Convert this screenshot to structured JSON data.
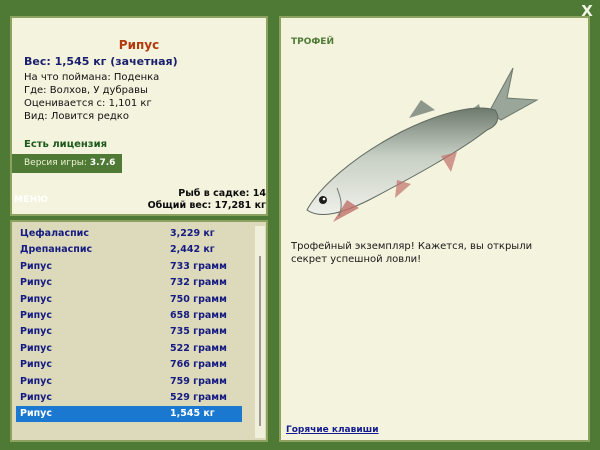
{
  "window": {
    "close_label": "X"
  },
  "catch_info": {
    "fish_name": "Рипус",
    "weight": "Вес: 1,545 кг (зачетная)",
    "bait": "На что поймана: Поденка",
    "location": "Где: Волхов, У дубравы",
    "valued_from": "Оценивается с: 1,101 кг",
    "kind": "Вид: Ловится редко",
    "license": "Есть лицензия",
    "version_label": "Версия игры:",
    "version_value": "3.7.6"
  },
  "menu_label": "МЕНЮ",
  "summary": {
    "fish_count": "Рыб в садке: 14",
    "total_weight": "Общий вес: 17,281 кг"
  },
  "catch_list": [
    {
      "name": "Цефаласпис",
      "weight": "3,229 кг"
    },
    {
      "name": "Дрепанаспис",
      "weight": "2,442 кг"
    },
    {
      "name": "Рипус",
      "weight": "733 грамм"
    },
    {
      "name": "Рипус",
      "weight": "732 грамм"
    },
    {
      "name": "Рипус",
      "weight": "750 грамм"
    },
    {
      "name": "Рипус",
      "weight": "658 грамм"
    },
    {
      "name": "Рипус",
      "weight": "735 грамм"
    },
    {
      "name": "Рипус",
      "weight": "522 грамм"
    },
    {
      "name": "Рипус",
      "weight": "766 грамм"
    },
    {
      "name": "Рипус",
      "weight": "759 грамм"
    },
    {
      "name": "Рипус",
      "weight": "529 грамм"
    },
    {
      "name": "Рипус",
      "weight": "1,545 кг"
    }
  ],
  "trophy": {
    "title": "ТРОФЕЙ",
    "text": "Трофейный экземпляр! Кажется, вы открыли секрет успешной ловли!",
    "hotkeys": "Горячие клавиши"
  },
  "icons": {
    "close": "close-icon",
    "fish": "fish-image"
  },
  "colors": {
    "background": "#4f7a36",
    "panel": "#f4f3de",
    "selected": "#1b78d0",
    "fish_name": "#b23a0d"
  }
}
